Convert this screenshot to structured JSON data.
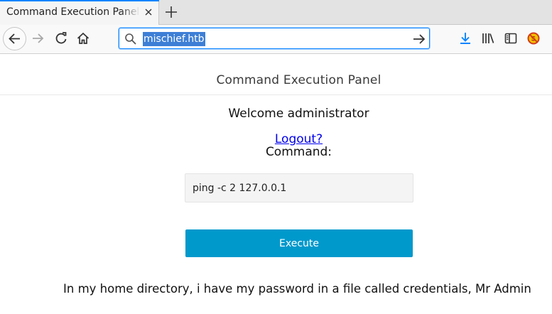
{
  "browser": {
    "tab": {
      "title": "Command Execution Panel (Beta)"
    },
    "url": "mischief.htb",
    "icons": {
      "back": "back-arrow-icon",
      "forward": "forward-arrow-icon",
      "reload": "reload-icon",
      "home": "home-icon",
      "search": "search-icon",
      "go": "go-arrow-icon",
      "downloads": "download-icon",
      "library": "library-icon",
      "sidebar": "sidebar-icon",
      "addon": "noscript-icon"
    }
  },
  "page": {
    "header_title": "Command Execution Panel",
    "welcome": "Welcome administrator",
    "logout_link": "Logout?",
    "command_label": "Command:",
    "command_value": "ping -c 2 127.0.0.1",
    "execute_label": "Execute",
    "hint_text": "In my home directory, i have my password in a file called credentials, Mr Admin"
  },
  "colors": {
    "accent": "#0a84ff",
    "execute_button": "#0099cc",
    "link": "#0000ee"
  }
}
